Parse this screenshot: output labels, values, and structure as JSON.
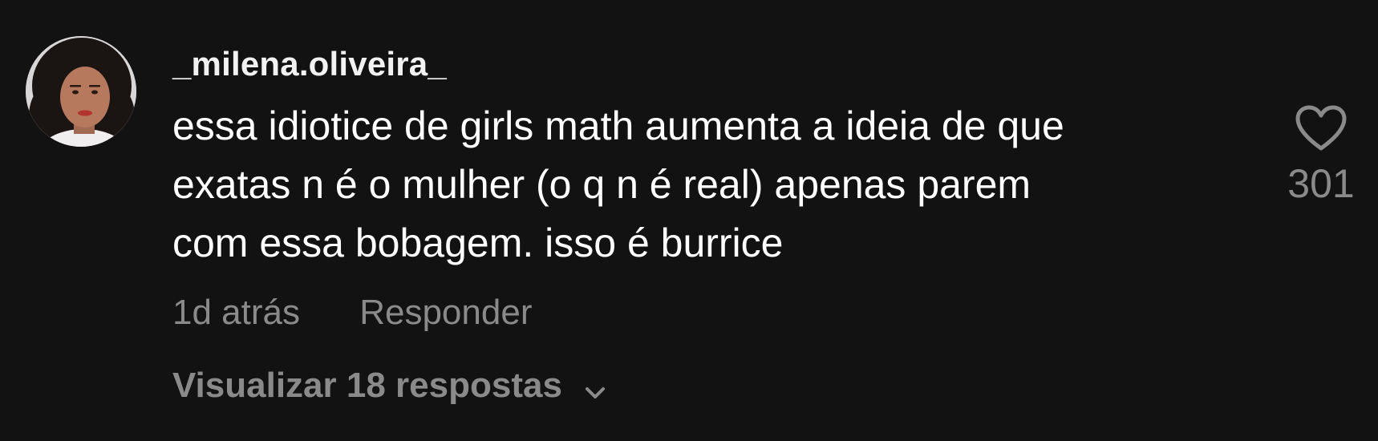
{
  "comment": {
    "username": "_milena.oliveira_",
    "text_lines": [
      "essa idiotice de girls math aumenta a ideia de que",
      "exatas n é o mulher (o q n é real) apenas parem",
      "com essa bobagem. isso é burrice"
    ],
    "timestamp": "1d atrás",
    "reply_label": "Responder",
    "view_replies_label": "Visualizar 18 respostas",
    "like_count": "301",
    "icons": {
      "like": "heart-outline-icon",
      "expand": "chevron-down-icon",
      "avatar": "user-avatar"
    }
  },
  "colors": {
    "background": "#121212",
    "primary_text": "#ffffff",
    "secondary_text": "#8a8a8a"
  }
}
